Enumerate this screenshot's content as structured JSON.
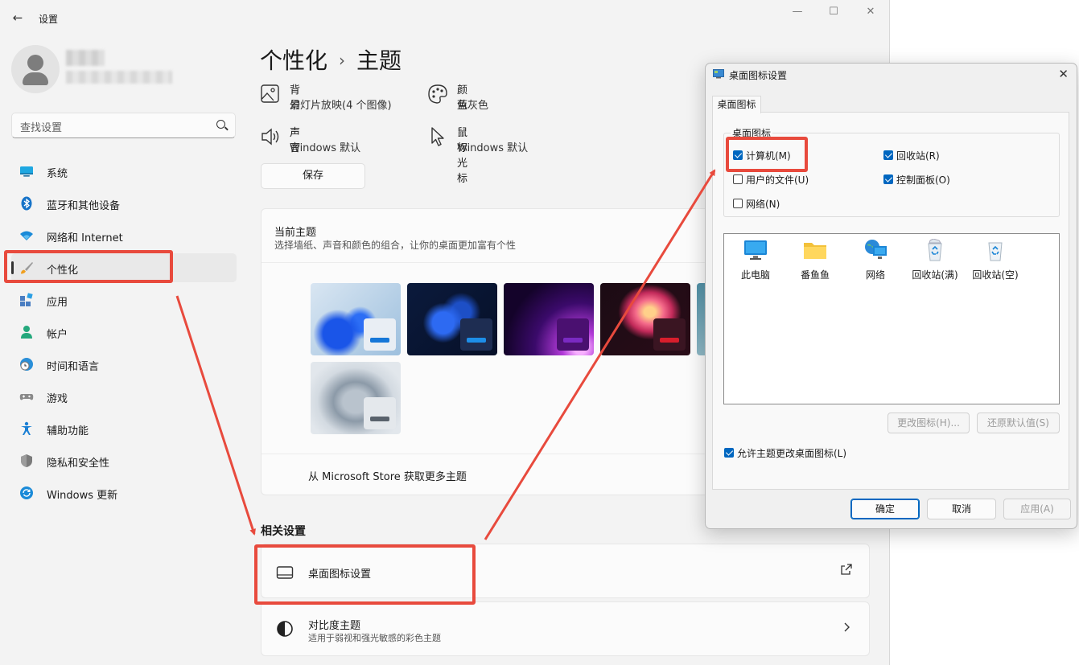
{
  "settings": {
    "title": "设置",
    "search_placeholder": "查找设置",
    "nav": [
      {
        "label": "系统",
        "icon": "monitor-icon"
      },
      {
        "label": "蓝牙和其他设备",
        "icon": "bluetooth-icon"
      },
      {
        "label": "网络和 Internet",
        "icon": "wifi-icon"
      },
      {
        "label": "个性化",
        "icon": "brush-icon",
        "selected": true
      },
      {
        "label": "应用",
        "icon": "apps-icon"
      },
      {
        "label": "帐户",
        "icon": "person-icon"
      },
      {
        "label": "时间和语言",
        "icon": "globe-clock-icon"
      },
      {
        "label": "游戏",
        "icon": "gamepad-icon"
      },
      {
        "label": "辅助功能",
        "icon": "accessibility-icon"
      },
      {
        "label": "隐私和安全性",
        "icon": "shield-icon"
      },
      {
        "label": "Windows 更新",
        "icon": "update-icon"
      }
    ],
    "breadcrumb": {
      "parent": "个性化",
      "separator": "›",
      "current": "主题"
    },
    "props": {
      "background": {
        "title": "背景",
        "value": "幻灯片放映(4 个图像)"
      },
      "color": {
        "title": "颜色",
        "value": "蓝灰色"
      },
      "sound": {
        "title": "声音",
        "value": "Windows 默认"
      },
      "cursor": {
        "title": "鼠标光标",
        "value": "Windows 默认"
      }
    },
    "save_label": "保存",
    "current_theme": {
      "title": "当前主题",
      "subtitle": "选择墙纸、声音和颜色的组合，让你的桌面更加富有个性",
      "themes": [
        "windows-light",
        "windows-dark",
        "glow",
        "captured-motion",
        "flow",
        "sunrise"
      ],
      "store_link": "从 Microsoft Store 获取更多主题"
    },
    "related": {
      "title": "相关设置",
      "desktop_icons": "桌面图标设置",
      "contrast_title": "对比度主题",
      "contrast_sub": "适用于弱视和强光敏感的彩色主题"
    }
  },
  "dialog": {
    "title": "桌面图标设置",
    "tab": "桌面图标",
    "group_label": "桌面图标",
    "checkboxes": {
      "computer": {
        "label": "计算机(M)",
        "checked": true
      },
      "recycle": {
        "label": "回收站(R)",
        "checked": true
      },
      "user_files": {
        "label": "用户的文件(U)",
        "checked": false
      },
      "control_panel": {
        "label": "控制面板(O)",
        "checked": true
      },
      "network": {
        "label": "网络(N)",
        "checked": false
      }
    },
    "icons": [
      {
        "label": "此电脑",
        "icon": "pc-icon"
      },
      {
        "label": "番鱼鱼",
        "icon": "folder-icon"
      },
      {
        "label": "网络",
        "icon": "network-icon"
      },
      {
        "label": "回收站(满)",
        "icon": "recycle-bin-full-icon"
      },
      {
        "label": "回收站(空)",
        "icon": "recycle-bin-empty-icon"
      }
    ],
    "change_icon": "更改图标(H)...",
    "restore_default": "还原默认值(S)",
    "allow_themes": {
      "label": "允许主题更改桌面图标(L)",
      "checked": true
    },
    "ok": "确定",
    "cancel": "取消",
    "apply": "应用(A)"
  },
  "colors": {
    "accent": "#0067c0",
    "annotation": "#e84a3d"
  }
}
